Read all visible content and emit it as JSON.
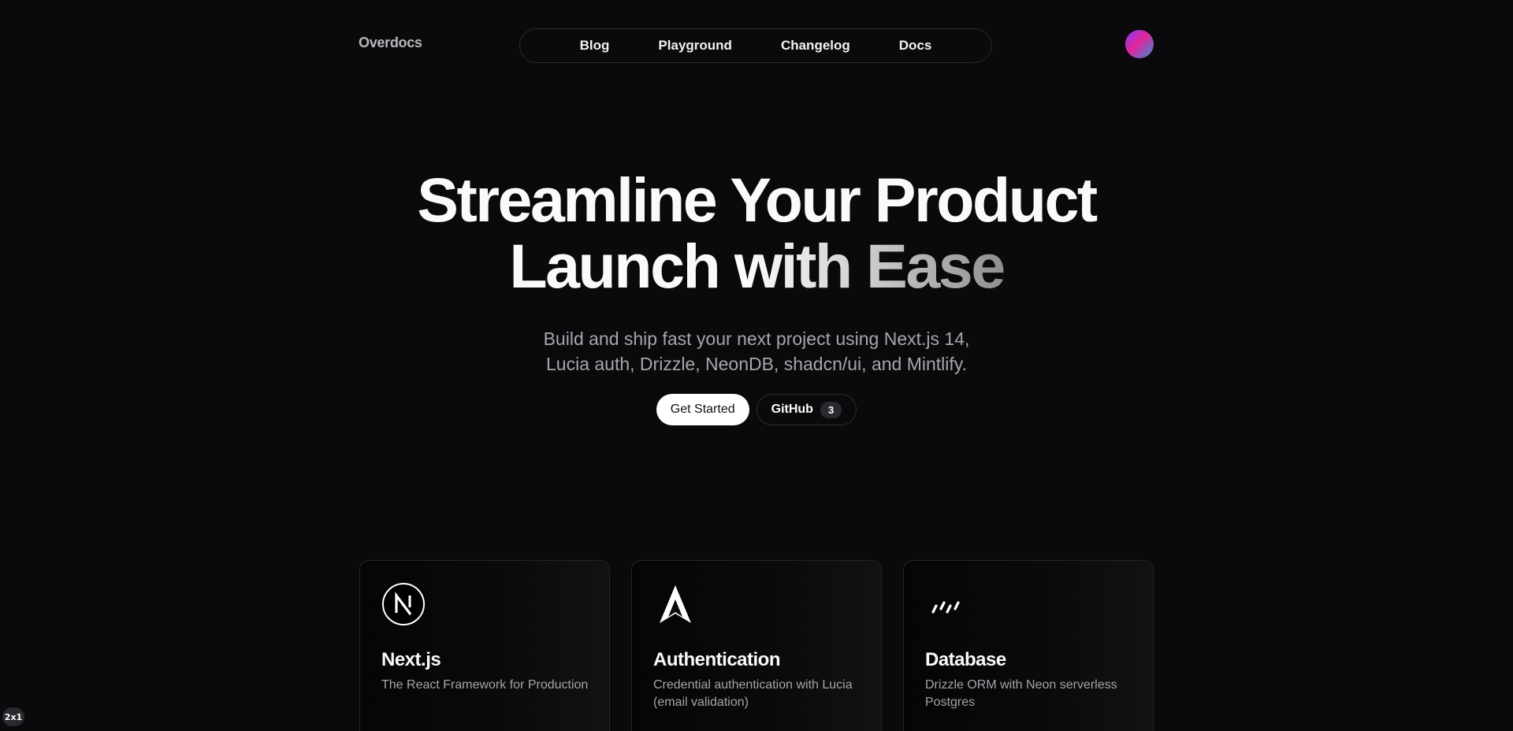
{
  "header": {
    "logo": "Overdocs",
    "nav": [
      "Blog",
      "Playground",
      "Changelog",
      "Docs"
    ],
    "avatar_icon": "gradient-avatar"
  },
  "hero": {
    "title_line1": "Streamline Your Product",
    "title_line2_plain": "Launch",
    "title_line2_gradient": "with Ease",
    "subtitle_line1": "Build and ship fast your next project using Next.js 14,",
    "subtitle_line2": "Lucia auth, Drizzle, NeonDB, shadcn/ui, and Mintlify.",
    "cta_primary": "Get Started",
    "cta_github": "GitHub",
    "github_count": "3"
  },
  "features": [
    {
      "title": "Next.js",
      "description": "The React Framework for Production",
      "icon": "nextjs-icon"
    },
    {
      "title": "Authentication",
      "description": "Credential authentication with Lucia (email validation)",
      "icon": "lucia-icon"
    },
    {
      "title": "Database",
      "description": "Drizzle ORM with Neon serverless Postgres",
      "icon": "drizzle-icon"
    }
  ],
  "corner_badge": "2x1",
  "colors": {
    "background": "#0a0a0c",
    "text": "#fafafa",
    "muted": "#a6a6ab",
    "border": "#2a2a2e"
  }
}
